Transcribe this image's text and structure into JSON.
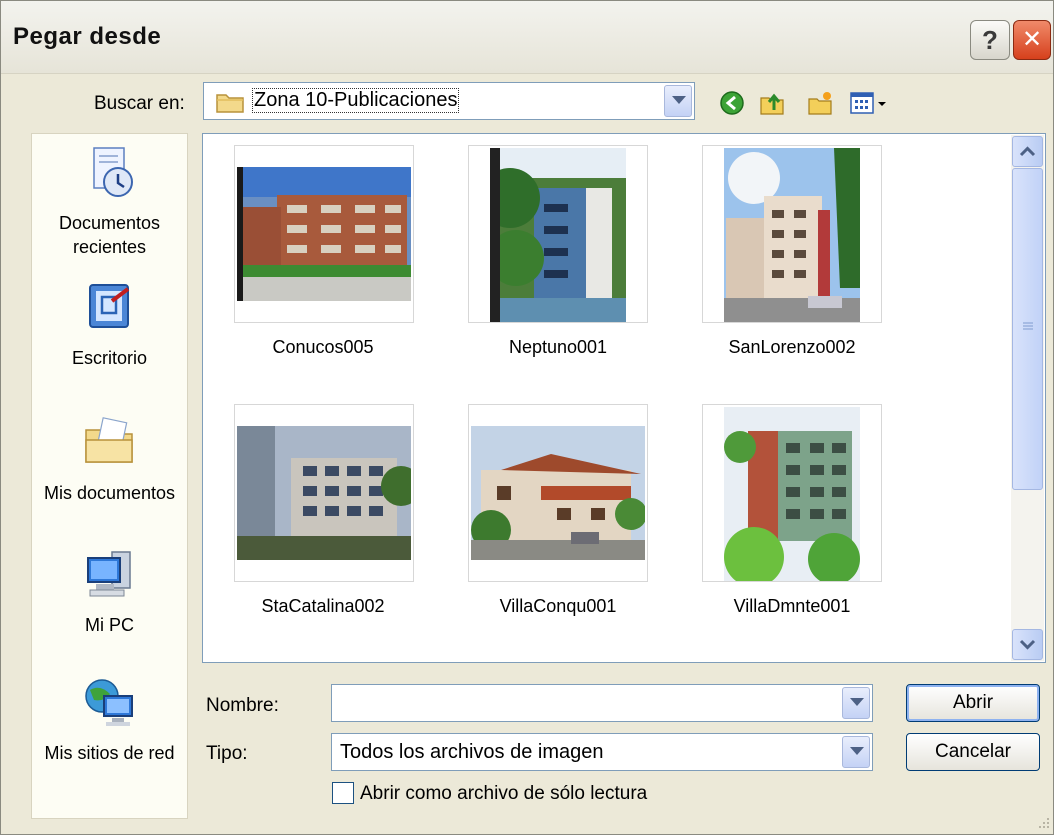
{
  "window": {
    "title": "Pegar desde",
    "help_label": "?",
    "close_label": "✕"
  },
  "toolbar": {
    "look_in_label": "Buscar en:",
    "location": "Zona 10-Publicaciones",
    "icons": [
      "back-icon",
      "up-folder-icon",
      "new-folder-icon",
      "views-menu-icon"
    ]
  },
  "places": [
    {
      "label": "Documentos recientes",
      "icon": "recent-documents-icon"
    },
    {
      "label": "Escritorio",
      "icon": "desktop-icon"
    },
    {
      "label": "Mis documentos",
      "icon": "my-documents-icon"
    },
    {
      "label": "Mi PC",
      "icon": "my-computer-icon"
    },
    {
      "label": "Mis sitios de red",
      "icon": "network-places-icon"
    }
  ],
  "files": [
    {
      "name": "Conucos005"
    },
    {
      "name": "Neptuno001"
    },
    {
      "name": "SanLorenzo002"
    },
    {
      "name": "StaCatalina002"
    },
    {
      "name": "VillaConqu001"
    },
    {
      "name": "VillaDmnte001"
    }
  ],
  "form": {
    "name_label": "Nombre:",
    "name_value": "",
    "type_label": "Tipo:",
    "type_value": "Todos los archivos de imagen",
    "readonly_label": "Abrir como archivo de sólo lectura",
    "readonly_checked": false
  },
  "buttons": {
    "open": "Abrir",
    "cancel": "Cancelar"
  }
}
